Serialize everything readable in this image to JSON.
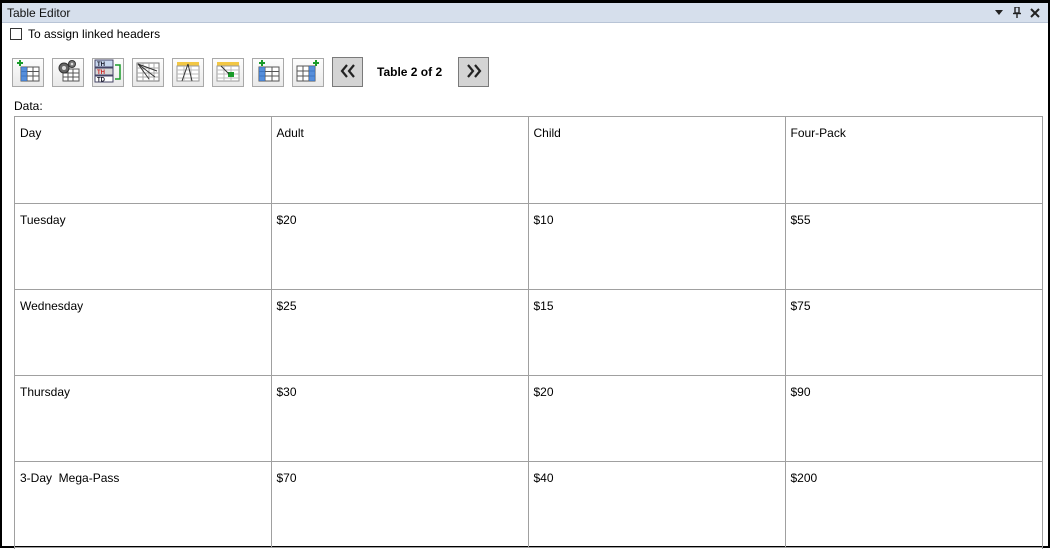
{
  "window": {
    "title": "Table Editor"
  },
  "options": {
    "assign_linked_headers_label": "To assign linked headers",
    "assign_linked_headers_checked": false
  },
  "toolbar": {
    "buttons": [
      {
        "icon": "insert-table-icon"
      },
      {
        "icon": "table-properties-icon"
      },
      {
        "icon": "header-cell-types-icon"
      },
      {
        "icon": "link-headers-icon"
      },
      {
        "icon": "header-scope-icon"
      },
      {
        "icon": "merge-cells-icon"
      },
      {
        "icon": "insert-column-icon"
      },
      {
        "icon": "insert-row-icon"
      }
    ],
    "prev_icon": "double-chevron-left-icon",
    "next_icon": "double-chevron-right-icon",
    "table_position": "Table 2 of 2"
  },
  "data_section": {
    "label": "Data:",
    "rows": [
      [
        "Day",
        "Adult",
        "Child",
        "Four-Pack"
      ],
      [
        "Tuesday",
        "$20",
        "$10",
        "$55"
      ],
      [
        "Wednesday",
        "$25",
        "$15",
        "$75"
      ],
      [
        "Thursday",
        "$30",
        "$20",
        "$90"
      ],
      [
        "3-Day  Mega-Pass",
        "$70",
        "$40",
        "$200"
      ]
    ]
  }
}
